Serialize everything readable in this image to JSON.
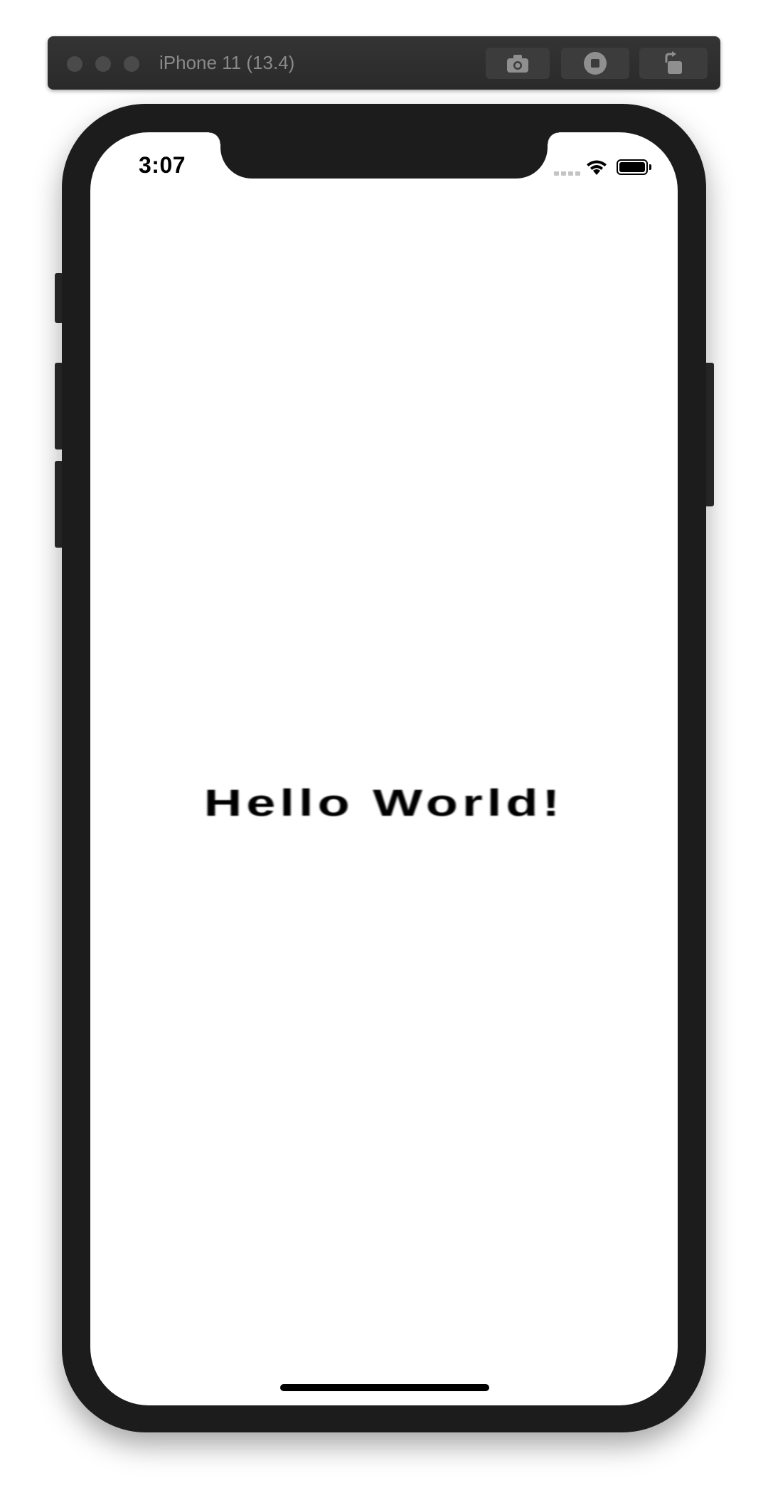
{
  "simulator": {
    "title": "iPhone 11 (13.4)",
    "buttons": {
      "screenshot_icon": "camera-icon",
      "home_icon": "stop-icon",
      "rotate_icon": "rotate-icon"
    }
  },
  "status_bar": {
    "time": "3:07",
    "icons": [
      "signal-dots-icon",
      "wifi-icon",
      "battery-icon"
    ]
  },
  "app": {
    "text": "Hello World!"
  },
  "colors": {
    "titlebar": "#2e2e2e",
    "device_frame": "#1c1c1c",
    "screen": "#ffffff",
    "text": "#000000"
  }
}
